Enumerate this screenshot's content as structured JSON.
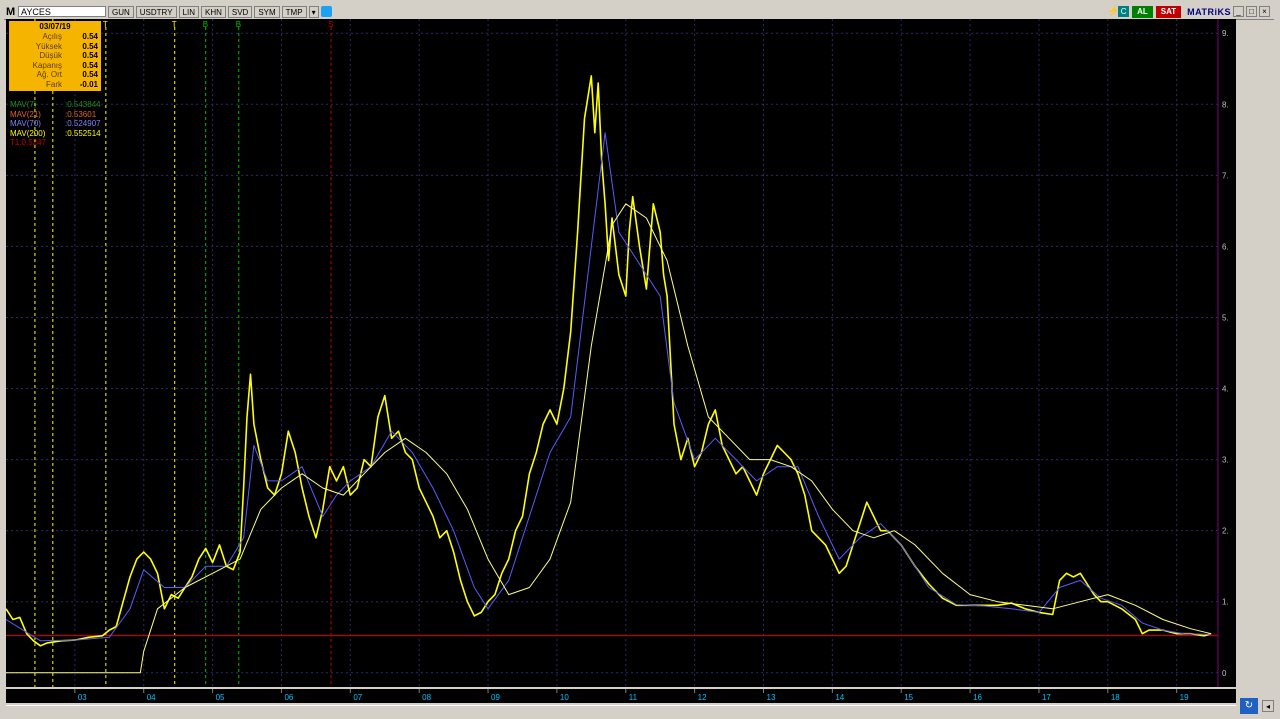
{
  "toolbar": {
    "logo": "M",
    "symbol": "AYCES",
    "buttons": [
      "GUN",
      "USDTRY",
      "LIN",
      "KHN",
      "SVD",
      "SYM",
      "TMP"
    ],
    "al_label": "AL",
    "sat_label": "SAT",
    "brand": "MATRiKS",
    "win_minimize": "_",
    "win_maximize": "□",
    "win_close": "×"
  },
  "info": {
    "date": "03/07/19",
    "rows": [
      {
        "label": "Açılış",
        "value": "0.54"
      },
      {
        "label": "Yüksek",
        "value": "0.54"
      },
      {
        "label": "Düşük",
        "value": "0.54"
      },
      {
        "label": "Kapanış",
        "value": "0.54"
      },
      {
        "label": "Ağ. Ort",
        "value": "0.54"
      },
      {
        "label": "Fark",
        "value": "-0.01"
      }
    ]
  },
  "indicators": [
    {
      "label": "MAV(7)",
      "value": ":0.543844",
      "color": "#1e8c1e"
    },
    {
      "label": "MAV(21)",
      "value": ":0.53601",
      "color": "#e06030"
    },
    {
      "label": "MAV(70)",
      "value": ":0.524907",
      "color": "#8080ff"
    },
    {
      "label": "MAV(200)",
      "value": ":0.552514",
      "color": "#ffff00"
    },
    {
      "label": "T1:0.5247",
      "value": "",
      "color": "#c00000"
    }
  ],
  "chart_data": {
    "type": "line",
    "x_tick_labels": [
      "03",
      "04",
      "05",
      "06",
      "07",
      "08",
      "09",
      "10",
      "11",
      "12",
      "13",
      "14",
      "15",
      "16",
      "17",
      "18",
      "19"
    ],
    "y_tick_labels": [
      "0",
      "1.",
      "2.",
      "3.",
      "4.",
      "5.",
      "6.",
      "7.",
      "8.",
      "9."
    ],
    "ylim": [
      -0.2,
      9.2
    ],
    "xlim": [
      2002.0,
      2019.6
    ],
    "horizontal_line": {
      "value": 0.5247,
      "color": "#c00000"
    },
    "signals": [
      {
        "label": "T",
        "x": 2003.45,
        "color": "#ffff00"
      },
      {
        "label": "T",
        "x": 2004.45,
        "color": "#ffff00"
      },
      {
        "label": "B",
        "x": 2004.9,
        "color": "#00c000"
      },
      {
        "label": "B",
        "x": 2005.38,
        "color": "#00c000"
      },
      {
        "label": "S",
        "x": 2006.72,
        "color": "#c00000"
      }
    ],
    "extra_vlines": [
      {
        "x": 2002.42,
        "color": "#ffff00"
      },
      {
        "x": 2002.68,
        "color": "#ffff00"
      }
    ],
    "series": [
      {
        "color": "#ffff00",
        "x": [
          2002.0,
          2002.1,
          2002.2,
          2002.3,
          2002.4,
          2002.5,
          2002.6,
          2002.8,
          2003.0,
          2003.2,
          2003.4,
          2003.5,
          2003.6,
          2003.7,
          2003.8,
          2003.9,
          2004.0,
          2004.1,
          2004.2,
          2004.3,
          2004.4,
          2004.5,
          2004.6,
          2004.7,
          2004.8,
          2004.9,
          2005.0,
          2005.1,
          2005.2,
          2005.3,
          2005.4,
          2005.45,
          2005.5,
          2005.55,
          2005.6,
          2005.7,
          2005.8,
          2005.9,
          2006.0,
          2006.1,
          2006.2,
          2006.3,
          2006.4,
          2006.5,
          2006.6,
          2006.7,
          2006.8,
          2006.9,
          2007.0,
          2007.1,
          2007.2,
          2007.3,
          2007.4,
          2007.5,
          2007.6,
          2007.7,
          2007.8,
          2007.9,
          2008.0,
          2008.1,
          2008.2,
          2008.3,
          2008.4,
          2008.5,
          2008.6,
          2008.7,
          2008.8,
          2008.9,
          2009.0,
          2009.1,
          2009.2,
          2009.3,
          2009.4,
          2009.5,
          2009.6,
          2009.7,
          2009.8,
          2009.9,
          2010.0,
          2010.1,
          2010.2,
          2010.3,
          2010.4,
          2010.5,
          2010.55,
          2010.6,
          2010.65,
          2010.7,
          2010.75,
          2010.8,
          2010.9,
          2011.0,
          2011.05,
          2011.1,
          2011.2,
          2011.3,
          2011.4,
          2011.5,
          2011.55,
          2011.6,
          2011.7,
          2011.8,
          2011.9,
          2012.0,
          2012.1,
          2012.2,
          2012.3,
          2012.4,
          2012.5,
          2012.6,
          2012.7,
          2012.8,
          2012.9,
          2013.0,
          2013.1,
          2013.2,
          2013.3,
          2013.4,
          2013.5,
          2013.6,
          2013.7,
          2013.8,
          2013.9,
          2014.0,
          2014.1,
          2014.2,
          2014.3,
          2014.4,
          2014.5,
          2014.6,
          2014.7,
          2014.8,
          2014.9,
          2015.0,
          2015.2,
          2015.4,
          2015.6,
          2015.8,
          2016.0,
          2016.2,
          2016.4,
          2016.6,
          2016.8,
          2017.0,
          2017.2,
          2017.3,
          2017.4,
          2017.5,
          2017.6,
          2017.7,
          2017.8,
          2017.9,
          2018.0,
          2018.2,
          2018.4,
          2018.5,
          2018.6,
          2018.8,
          2019.0,
          2019.2,
          2019.4,
          2019.5
        ],
        "y": [
          0.9,
          0.75,
          0.78,
          0.55,
          0.45,
          0.38,
          0.42,
          0.45,
          0.46,
          0.5,
          0.52,
          0.6,
          0.65,
          1.0,
          1.35,
          1.6,
          1.7,
          1.6,
          1.4,
          0.9,
          1.1,
          1.05,
          1.2,
          1.35,
          1.6,
          1.75,
          1.55,
          1.8,
          1.5,
          1.45,
          1.7,
          2.6,
          3.6,
          4.2,
          3.5,
          3.0,
          2.6,
          2.5,
          2.8,
          3.4,
          3.1,
          2.6,
          2.2,
          1.9,
          2.3,
          2.9,
          2.7,
          2.9,
          2.5,
          2.6,
          3.0,
          2.9,
          3.6,
          3.9,
          3.3,
          3.4,
          3.1,
          3.0,
          2.6,
          2.4,
          2.2,
          1.9,
          2.0,
          1.7,
          1.3,
          1.0,
          0.8,
          0.85,
          1.0,
          1.1,
          1.4,
          1.6,
          2.0,
          2.2,
          2.8,
          3.1,
          3.5,
          3.7,
          3.5,
          4.0,
          4.8,
          6.2,
          7.8,
          8.4,
          7.6,
          8.3,
          7.2,
          6.6,
          5.8,
          6.4,
          5.6,
          5.3,
          6.2,
          6.7,
          6.0,
          5.4,
          6.6,
          6.2,
          5.6,
          5.3,
          3.5,
          3.0,
          3.3,
          2.9,
          3.1,
          3.5,
          3.7,
          3.2,
          3.0,
          2.8,
          2.9,
          2.7,
          2.5,
          2.8,
          3.0,
          3.2,
          3.1,
          3.0,
          2.8,
          2.5,
          2.0,
          1.9,
          1.8,
          1.6,
          1.4,
          1.5,
          1.8,
          2.1,
          2.4,
          2.2,
          2.0,
          2.0,
          1.9,
          1.8,
          1.5,
          1.25,
          1.05,
          0.95,
          0.95,
          0.95,
          0.95,
          0.98,
          0.9,
          0.85,
          0.82,
          1.3,
          1.4,
          1.35,
          1.4,
          1.25,
          1.1,
          1.0,
          1.0,
          0.9,
          0.75,
          0.55,
          0.6,
          0.6,
          0.55,
          0.55,
          0.52,
          0.55
        ]
      },
      {
        "color": "#5a5aff",
        "x": [
          2002.0,
          2002.5,
          2003.0,
          2003.5,
          2003.8,
          2004.0,
          2004.3,
          2004.6,
          2004.9,
          2005.2,
          2005.45,
          2005.6,
          2005.8,
          2006.0,
          2006.3,
          2006.6,
          2006.8,
          2007.0,
          2007.3,
          2007.6,
          2007.9,
          2008.2,
          2008.5,
          2008.8,
          2009.0,
          2009.3,
          2009.6,
          2009.9,
          2010.2,
          2010.5,
          2010.7,
          2010.9,
          2011.1,
          2011.3,
          2011.5,
          2011.7,
          2012.0,
          2012.3,
          2012.6,
          2012.9,
          2013.2,
          2013.5,
          2013.8,
          2014.1,
          2014.4,
          2014.7,
          2015.0,
          2015.4,
          2015.8,
          2016.2,
          2016.6,
          2017.0,
          2017.3,
          2017.6,
          2017.9,
          2018.2,
          2018.5,
          2018.8,
          2019.1,
          2019.5
        ],
        "y": [
          0.75,
          0.45,
          0.46,
          0.5,
          0.9,
          1.45,
          1.2,
          1.2,
          1.5,
          1.5,
          1.9,
          3.2,
          2.7,
          2.7,
          2.9,
          2.2,
          2.5,
          2.7,
          2.9,
          3.4,
          3.1,
          2.6,
          2.0,
          1.2,
          0.9,
          1.3,
          2.2,
          3.1,
          3.6,
          6.0,
          7.6,
          6.2,
          5.9,
          5.6,
          5.3,
          3.8,
          3.0,
          3.3,
          3.0,
          2.7,
          2.9,
          2.9,
          2.2,
          1.6,
          1.9,
          2.1,
          1.8,
          1.2,
          0.96,
          0.94,
          0.9,
          0.85,
          1.2,
          1.3,
          1.05,
          0.95,
          0.7,
          0.6,
          0.55,
          0.54
        ]
      },
      {
        "color": "#ffff80",
        "x": [
          2002.0,
          2003.0,
          2003.7,
          2003.95,
          2004.0,
          2004.2,
          2004.6,
          2005.0,
          2005.4,
          2005.7,
          2006.0,
          2006.3,
          2006.6,
          2006.9,
          2007.2,
          2007.5,
          2007.8,
          2008.1,
          2008.4,
          2008.7,
          2009.0,
          2009.3,
          2009.6,
          2009.9,
          2010.2,
          2010.5,
          2010.8,
          2011.0,
          2011.3,
          2011.6,
          2011.9,
          2012.2,
          2012.5,
          2012.8,
          2013.1,
          2013.4,
          2013.7,
          2014.0,
          2014.3,
          2014.6,
          2014.9,
          2015.2,
          2015.6,
          2016.0,
          2016.4,
          2016.8,
          2017.2,
          2017.6,
          2018.0,
          2018.4,
          2018.8,
          2019.2,
          2019.5
        ],
        "y": [
          0.0,
          0.0,
          0.0,
          0.0,
          0.3,
          0.9,
          1.2,
          1.4,
          1.6,
          2.3,
          2.6,
          2.8,
          2.6,
          2.5,
          2.8,
          3.1,
          3.3,
          3.1,
          2.8,
          2.3,
          1.6,
          1.1,
          1.2,
          1.6,
          2.4,
          4.6,
          6.3,
          6.6,
          6.4,
          5.8,
          4.6,
          3.6,
          3.3,
          3.0,
          3.0,
          2.9,
          2.7,
          2.3,
          2.0,
          1.9,
          2.0,
          1.8,
          1.4,
          1.1,
          1.0,
          0.95,
          0.9,
          1.0,
          1.1,
          0.95,
          0.75,
          0.62,
          0.55
        ]
      }
    ]
  },
  "corner_button": "↻",
  "corner_button2": "◂"
}
